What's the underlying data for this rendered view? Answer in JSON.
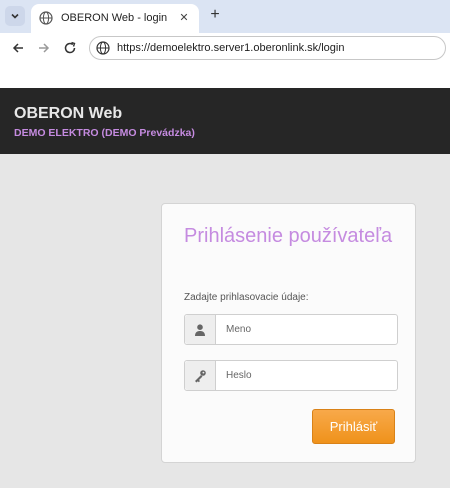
{
  "browser": {
    "tab_title": "OBERON Web - login",
    "tab_close": "✕",
    "new_tab": "+",
    "url": "https://demoelektro.server1.oberonlink.sk/login"
  },
  "header": {
    "brand": "OBERON Web",
    "subtitle": "DEMO ELEKTRO (DEMO Prevádzka)",
    "colors": {
      "background": "#262626",
      "accent": "#c58be0"
    }
  },
  "login": {
    "title": "Prihlásenie používateľa",
    "instruction": "Zadajte prihlasovacie údaje:",
    "username": {
      "placeholder": "Meno",
      "value": "",
      "icon": "user-icon"
    },
    "password": {
      "placeholder": "Heslo",
      "value": "",
      "icon": "key-icon"
    },
    "submit_label": "Prihlásiť",
    "colors": {
      "button": "#f39a26"
    }
  }
}
